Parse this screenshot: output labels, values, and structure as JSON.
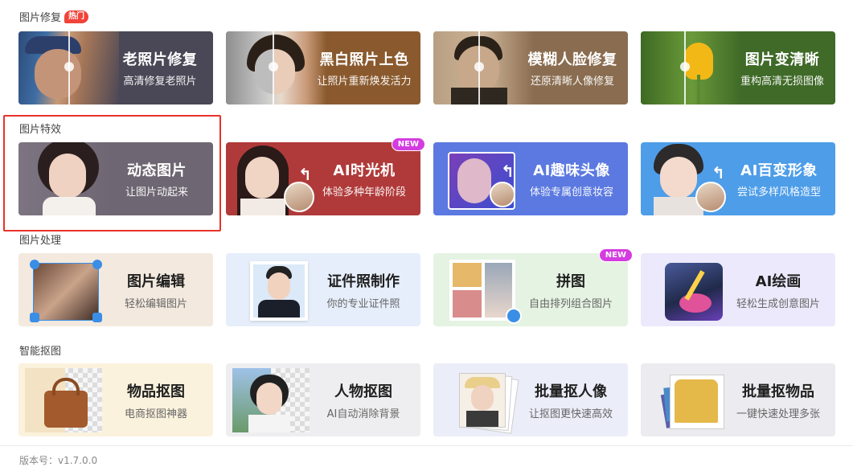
{
  "sections": {
    "repair": {
      "title": "图片修复",
      "badge": "热门"
    },
    "effects": {
      "title": "图片特效"
    },
    "process": {
      "title": "图片处理"
    },
    "cutout": {
      "title": "智能抠图"
    }
  },
  "repair_cards": [
    {
      "title": "老照片修复",
      "subtitle": "高清修复老照片",
      "color": "#4a4756"
    },
    {
      "title": "黑白照片上色",
      "subtitle": "让照片重新焕发活力",
      "color": "#8a5a2e"
    },
    {
      "title": "模糊人脸修复",
      "subtitle": "还原清晰人像修复",
      "color": "#8a6d50"
    },
    {
      "title": "图片变清晰",
      "subtitle": "重构高清无损图像",
      "color": "#3f6a28"
    }
  ],
  "effect_cards": [
    {
      "title": "动态图片",
      "subtitle": "让图片动起来",
      "color": "#6e6672"
    },
    {
      "title": "AI时光机",
      "subtitle": "体验多种年龄阶段",
      "color": "#b03a3a",
      "badge": "NEW"
    },
    {
      "title": "AI趣味头像",
      "subtitle": "体验专属创意妆容",
      "color": "#5b79e0"
    },
    {
      "title": "AI百变形象",
      "subtitle": "尝试多样风格造型",
      "color": "#4e9de8"
    }
  ],
  "process_cards": [
    {
      "title": "图片编辑",
      "subtitle": "轻松编辑图片",
      "color": "#f3e9de"
    },
    {
      "title": "证件照制作",
      "subtitle": "你的专业证件照",
      "color": "#e6eefb"
    },
    {
      "title": "拼图",
      "subtitle": "自由排列组合图片",
      "color": "#e5f3e2",
      "badge": "NEW"
    },
    {
      "title": "AI绘画",
      "subtitle": "轻松生成创意图片",
      "color": "#ebe9fb"
    }
  ],
  "cutout_cards": [
    {
      "title": "物品抠图",
      "subtitle": "电商抠图神器",
      "color": "#fbf2dd"
    },
    {
      "title": "人物抠图",
      "subtitle": "AI自动消除背景",
      "color": "#eeeef0"
    },
    {
      "title": "批量抠人像",
      "subtitle": "让抠图更快速高效",
      "color": "#ebedf8"
    },
    {
      "title": "批量抠物品",
      "subtitle": "一键快速处理多张",
      "color": "#ececf0"
    }
  ],
  "footer": {
    "version": "版本号：v1.7.0.0"
  }
}
